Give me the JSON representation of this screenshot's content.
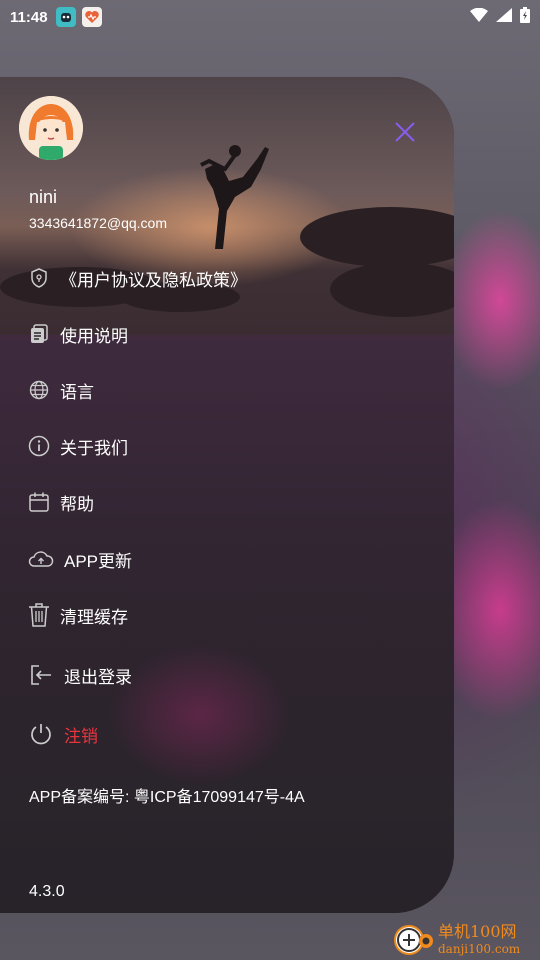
{
  "status_bar": {
    "time": "11:48"
  },
  "profile": {
    "username": "nini",
    "email": "3343641872@qq.com"
  },
  "menu": {
    "items": [
      {
        "label": "《用户协议及隐私政策》",
        "icon": "shield-icon"
      },
      {
        "label": "使用说明",
        "icon": "document-icon"
      },
      {
        "label": "语言",
        "icon": "globe-icon"
      },
      {
        "label": "关于我们",
        "icon": "info-icon"
      },
      {
        "label": "帮助",
        "icon": "calendar-icon"
      },
      {
        "label": "APP更新",
        "icon": "cloud-upload-icon"
      },
      {
        "label": "清理缓存",
        "icon": "trash-icon"
      },
      {
        "label": "退出登录",
        "icon": "logout-icon"
      },
      {
        "label": "注销",
        "icon": "power-icon"
      }
    ]
  },
  "footer": {
    "icp": "APP备案编号: 粤ICP备17099147号-4A",
    "version": "4.3.0"
  },
  "watermark": {
    "line1": "单机100网",
    "line2": "danji100.com"
  },
  "colors": {
    "accent": "#8a5cf0",
    "danger": "#e8353d",
    "panel": "#29242b"
  }
}
